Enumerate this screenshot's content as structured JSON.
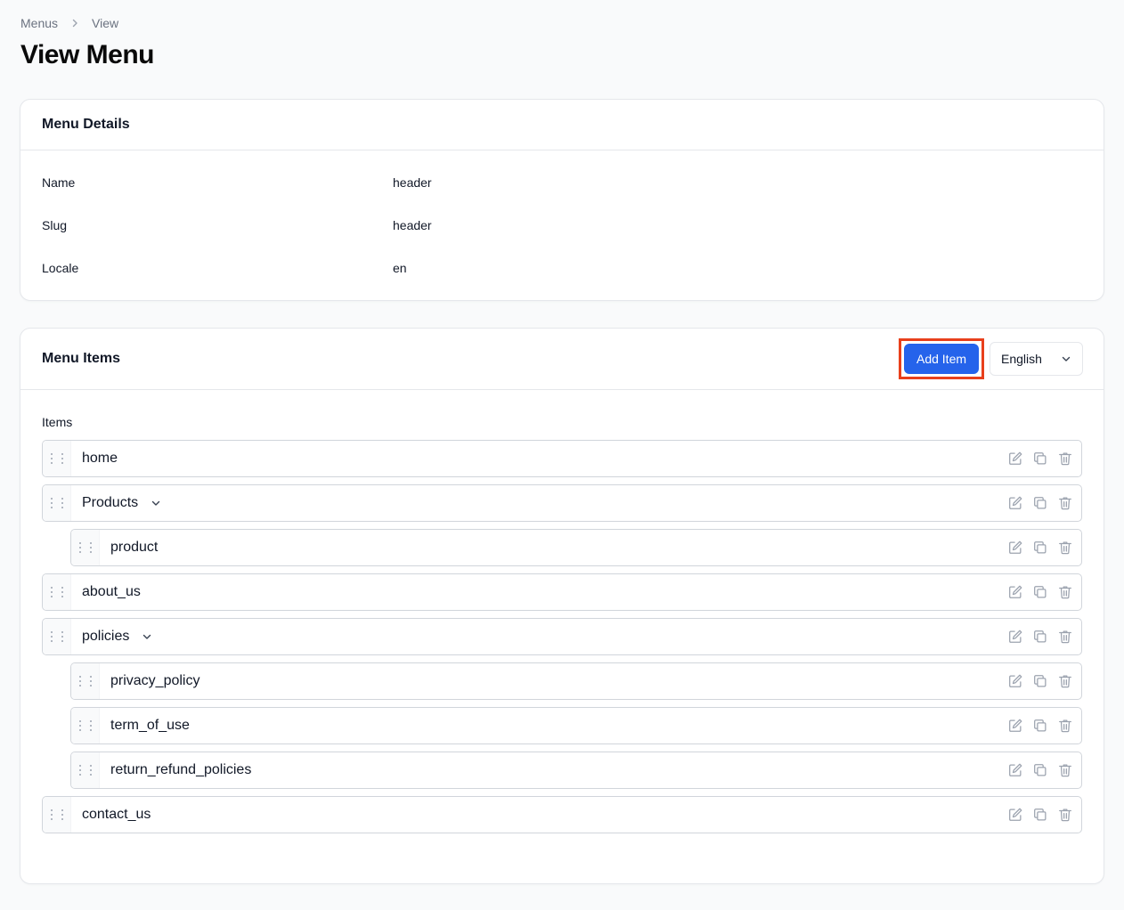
{
  "breadcrumb": {
    "parent": "Menus",
    "current": "View"
  },
  "page": {
    "title": "View Menu"
  },
  "details": {
    "title": "Menu Details",
    "rows": [
      {
        "label": "Name",
        "value": "header"
      },
      {
        "label": "Slug",
        "value": "header"
      },
      {
        "label": "Locale",
        "value": "en"
      }
    ]
  },
  "menu_items": {
    "title": "Menu Items",
    "add_label": "Add Item",
    "language": "English",
    "items_label": "Items",
    "items": [
      {
        "label": "home",
        "level": 0,
        "expandable": false
      },
      {
        "label": "Products",
        "level": 0,
        "expandable": true
      },
      {
        "label": "product",
        "level": 1,
        "expandable": false
      },
      {
        "label": "about_us",
        "level": 0,
        "expandable": false
      },
      {
        "label": "policies",
        "level": 0,
        "expandable": true
      },
      {
        "label": "privacy_policy",
        "level": 1,
        "expandable": false
      },
      {
        "label": "term_of_use",
        "level": 1,
        "expandable": false
      },
      {
        "label": "return_refund_policies",
        "level": 1,
        "expandable": false
      },
      {
        "label": "contact_us",
        "level": 0,
        "expandable": false
      }
    ]
  },
  "colors": {
    "primary": "#2563eb",
    "highlight": "#e8401c",
    "icon": "#9ca3af"
  }
}
